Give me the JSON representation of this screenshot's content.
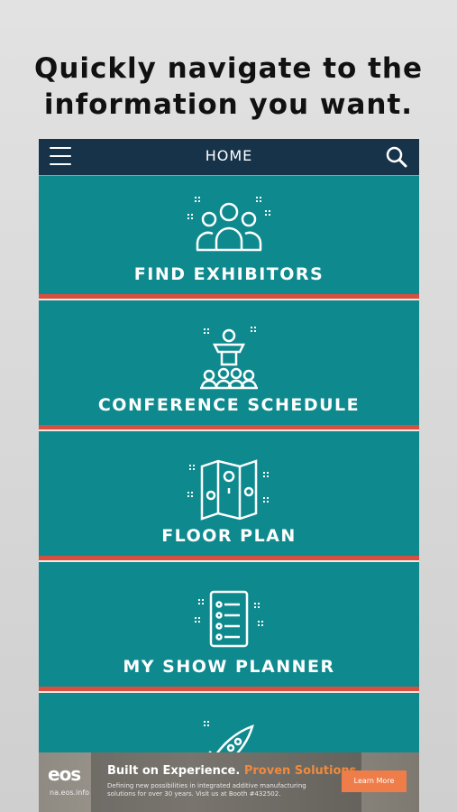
{
  "headline": {
    "line1": "Quickly navigate to the",
    "line2": "information you want."
  },
  "topbar": {
    "title": "HOME",
    "menu_icon": "hamburger-menu-icon",
    "search_icon": "search-icon"
  },
  "tiles": [
    {
      "label": "FIND EXHIBITORS",
      "icon": "people-group-icon"
    },
    {
      "label": "CONFERENCE SCHEDULE",
      "icon": "podium-audience-icon"
    },
    {
      "label": "FLOOR PLAN",
      "icon": "map-pins-icon"
    },
    {
      "label": "MY SHOW PLANNER",
      "icon": "checklist-icon"
    },
    {
      "label": "",
      "icon": "rocket-icon"
    }
  ],
  "ad": {
    "logo": "eos",
    "logo_sub": "na.eos.info",
    "headline_a": "Built on Experience.",
    "headline_b": "Proven Solutions.",
    "body": "Defining new possibilities in integrated additive manufacturing solutions for over 30 years. Visit us at Booth #432502.",
    "cta": "Learn More"
  },
  "colors": {
    "tile_bg": "#0e8a8f",
    "topbar_bg": "#17334a",
    "divider": "#d64f3f",
    "cta": "#ef7d4a"
  }
}
